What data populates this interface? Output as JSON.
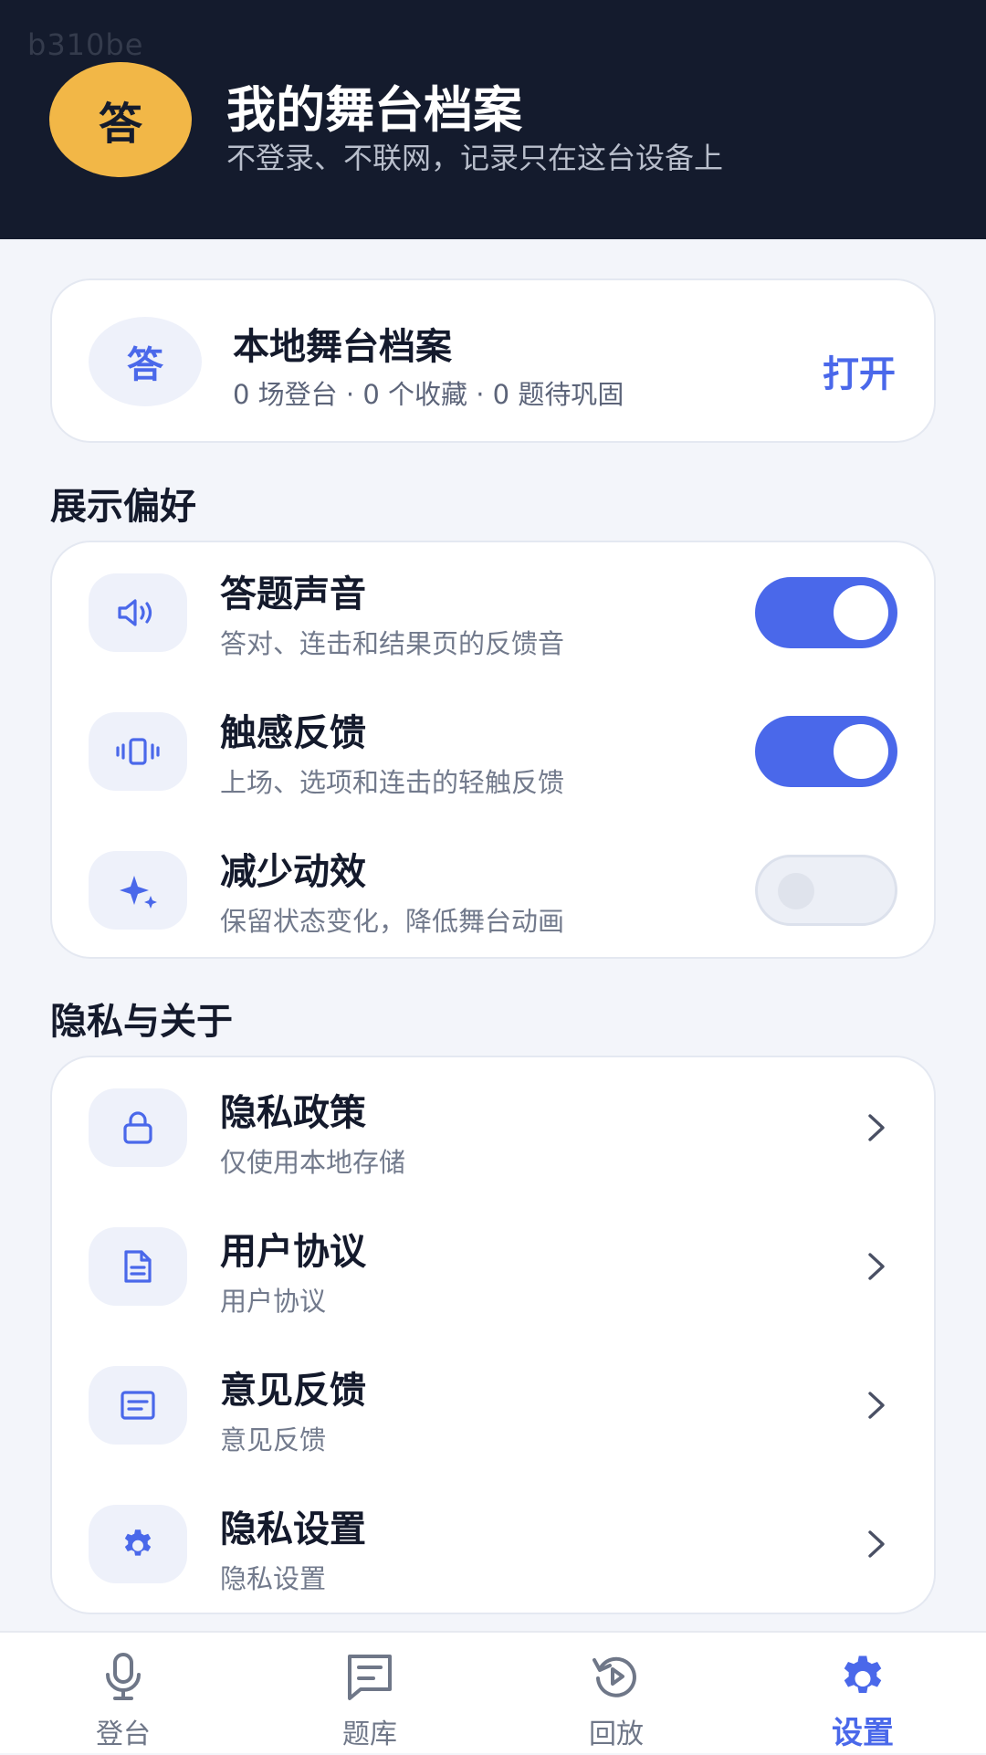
{
  "watermark": "b310be",
  "header": {
    "avatar_text": "答",
    "title": "我的舞台档案",
    "subtitle": "不登录、不联网，记录只在这台设备上"
  },
  "archive": {
    "avatar_text": "答",
    "title": "本地舞台档案",
    "stats": "0 场登台 · 0 个收藏 · 0 题待巩固",
    "open_label": "打开"
  },
  "display": {
    "section_title": "展示偏好",
    "items": [
      {
        "title": "答题声音",
        "subtitle": "答对、连击和结果页的反馈音",
        "icon": "speaker-icon",
        "enabled": true
      },
      {
        "title": "触感反馈",
        "subtitle": "上场、选项和连击的轻触反馈",
        "icon": "vibrate-icon",
        "enabled": true
      },
      {
        "title": "减少动效",
        "subtitle": "保留状态变化，降低舞台动画",
        "icon": "sparkle-icon",
        "enabled": false
      }
    ]
  },
  "privacy": {
    "section_title": "隐私与关于",
    "items": [
      {
        "title": "隐私政策",
        "subtitle": "仅使用本地存储",
        "icon": "lock-icon"
      },
      {
        "title": "用户协议",
        "subtitle": "用户协议",
        "icon": "document-icon"
      },
      {
        "title": "意见反馈",
        "subtitle": "意见反馈",
        "icon": "message-icon"
      },
      {
        "title": "隐私设置",
        "subtitle": "隐私设置",
        "icon": "gear-icon"
      }
    ]
  },
  "tabs": [
    {
      "label": "登台",
      "icon": "microphone-icon",
      "active": false
    },
    {
      "label": "题库",
      "icon": "question-bank-icon",
      "active": false
    },
    {
      "label": "回放",
      "icon": "replay-icon",
      "active": false
    },
    {
      "label": "设置",
      "icon": "gear-icon",
      "active": true
    }
  ],
  "colors": {
    "header_bg": "#141b2d",
    "accent": "#4a68ea",
    "avatar": "#f2b747",
    "page_bg": "#f3f5fa"
  }
}
